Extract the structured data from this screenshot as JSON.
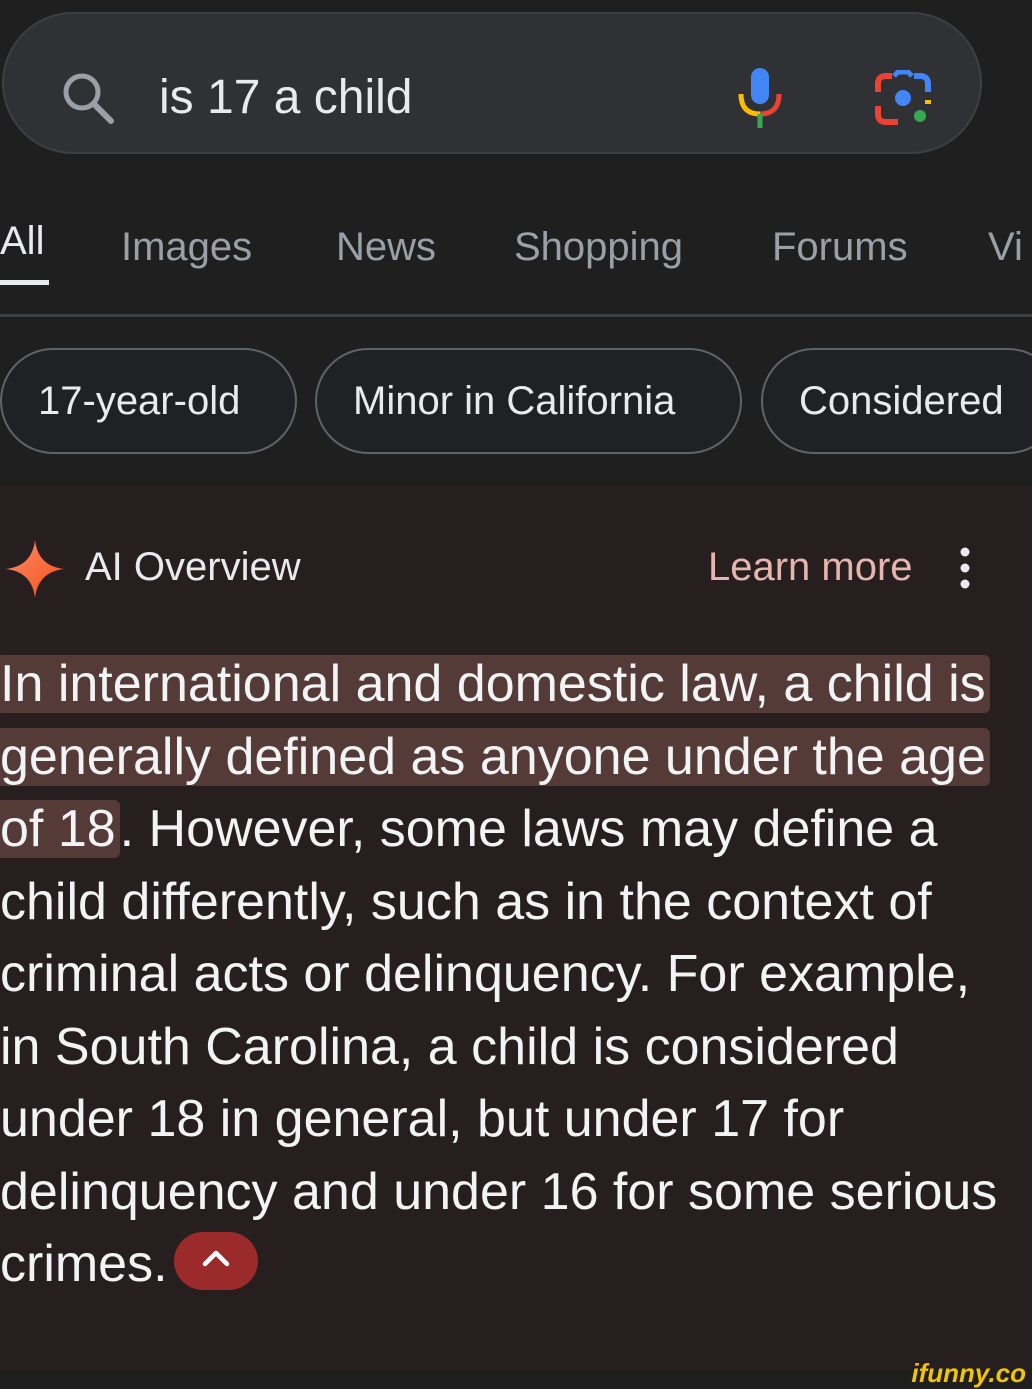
{
  "search": {
    "query": "is 17 a child"
  },
  "tabs": [
    "All",
    "Images",
    "News",
    "Shopping",
    "Forums",
    "Vi"
  ],
  "chips": [
    "17-year-old",
    "Minor in California",
    "Considered"
  ],
  "ai_overview": {
    "title": "AI Overview",
    "learn_more": "Learn more",
    "highlighted_text": "In international and domestic law, a child is generally defined as anyone under the age of 18",
    "body_text": ". However, some laws may define a child differently, such as in the context of criminal acts or delinquency. For example, in South Carolina, a child is considered under 18 in general, but under 17 for delinquency and under 16 for some serious crimes."
  },
  "watermark": "ifunny.co",
  "colors": {
    "background": "#1f1f1f",
    "ai_panel": "#271f1f",
    "highlight": "#553b38",
    "learn_more": "#e6b6ae",
    "collapse_button": "#9b2a2a"
  },
  "icons": [
    "search-icon",
    "mic-icon",
    "lens-icon",
    "spark-icon",
    "more-vert-icon",
    "chevron-up-icon"
  ]
}
